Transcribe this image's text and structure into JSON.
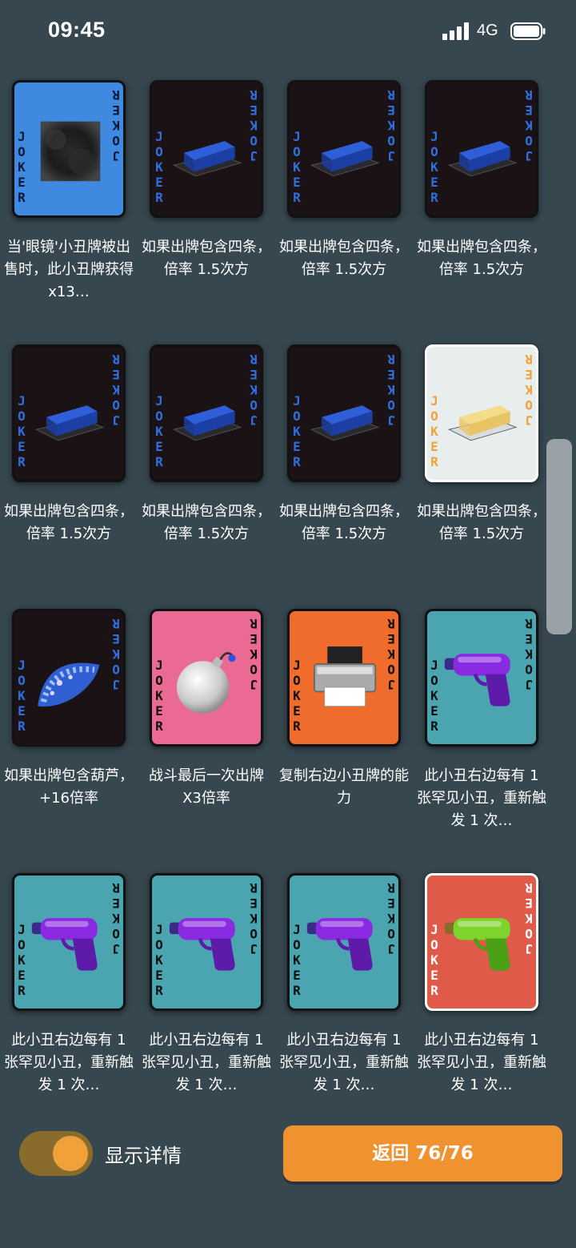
{
  "status_bar": {
    "time": "09:45",
    "network": "4G"
  },
  "cards": [
    {
      "bg": "#3f8ae0",
      "joker_color": "#0b1a3a",
      "art": "glasses-icon",
      "desc": "当'眼镜'小丑牌被出售时，此小丑牌获得 x13…"
    },
    {
      "bg": "#1a1214",
      "joker_color": "#2f6fe0",
      "art": "butter-icon",
      "desc": "如果出牌包含四条，倍率 1.5次方"
    },
    {
      "bg": "#1a1214",
      "joker_color": "#2f6fe0",
      "art": "butter-icon",
      "desc": "如果出牌包含四条，倍率 1.5次方"
    },
    {
      "bg": "#1a1214",
      "joker_color": "#2f6fe0",
      "art": "butter-icon",
      "desc": "如果出牌包含四条，倍率 1.5次方"
    },
    {
      "bg": "#1a1214",
      "joker_color": "#2f6fe0",
      "art": "butter-icon",
      "desc": "如果出牌包含四条，倍率 1.5次方"
    },
    {
      "bg": "#1a1214",
      "joker_color": "#2f6fe0",
      "art": "butter-icon",
      "desc": "如果出牌包含四条，倍率 1.5次方"
    },
    {
      "bg": "#1a1214",
      "joker_color": "#2f6fe0",
      "art": "butter-icon",
      "desc": "如果出牌包含四条，倍率 1.5次方"
    },
    {
      "bg": "#e8eeee",
      "joker_color": "#f0a33a",
      "art": "butter-icon",
      "desc": "如果出牌包含四条，倍率 1.5次方",
      "white_border": true
    },
    {
      "bg": "#1a1214",
      "joker_color": "#2f6fe0",
      "art": "taco-icon",
      "desc": "如果出牌包含葫芦，+16倍率"
    },
    {
      "bg": "#ea6a94",
      "joker_color": "#111111",
      "art": "bomb-icon",
      "desc": "战斗最后一次出牌 X3倍率"
    },
    {
      "bg": "#ef6c2c",
      "joker_color": "#111111",
      "art": "printer-icon",
      "desc": "复制右边小丑牌的能力"
    },
    {
      "bg": "#4aa5b0",
      "joker_color": "#111111",
      "art": "water-gun-icon",
      "desc": "此小丑右边每有 1 张罕见小丑，重新触发 1 次…"
    },
    {
      "bg": "#4aa5b0",
      "joker_color": "#111111",
      "art": "water-gun-icon",
      "desc": "此小丑右边每有 1 张罕见小丑，重新触发 1 次…"
    },
    {
      "bg": "#4aa5b0",
      "joker_color": "#111111",
      "art": "water-gun-icon",
      "desc": "此小丑右边每有 1 张罕见小丑，重新触发 1 次…"
    },
    {
      "bg": "#4aa5b0",
      "joker_color": "#111111",
      "art": "water-gun-icon",
      "desc": "此小丑右边每有 1 张罕见小丑，重新触发 1 次…"
    },
    {
      "bg": "#df5a48",
      "joker_color": "#ffffff",
      "art": "water-gun-icon",
      "desc": "此小丑右边每有 1 张罕见小丑，重新触发 1 次…",
      "white_border": true,
      "gun_color": "green"
    }
  ],
  "joker_text": "JOKER",
  "bottom": {
    "toggle_label": "显示详情",
    "toggle_on": true,
    "back_button": "返回 76/76"
  },
  "colors": {
    "background": "#37474f",
    "accent": "#f0922f"
  }
}
